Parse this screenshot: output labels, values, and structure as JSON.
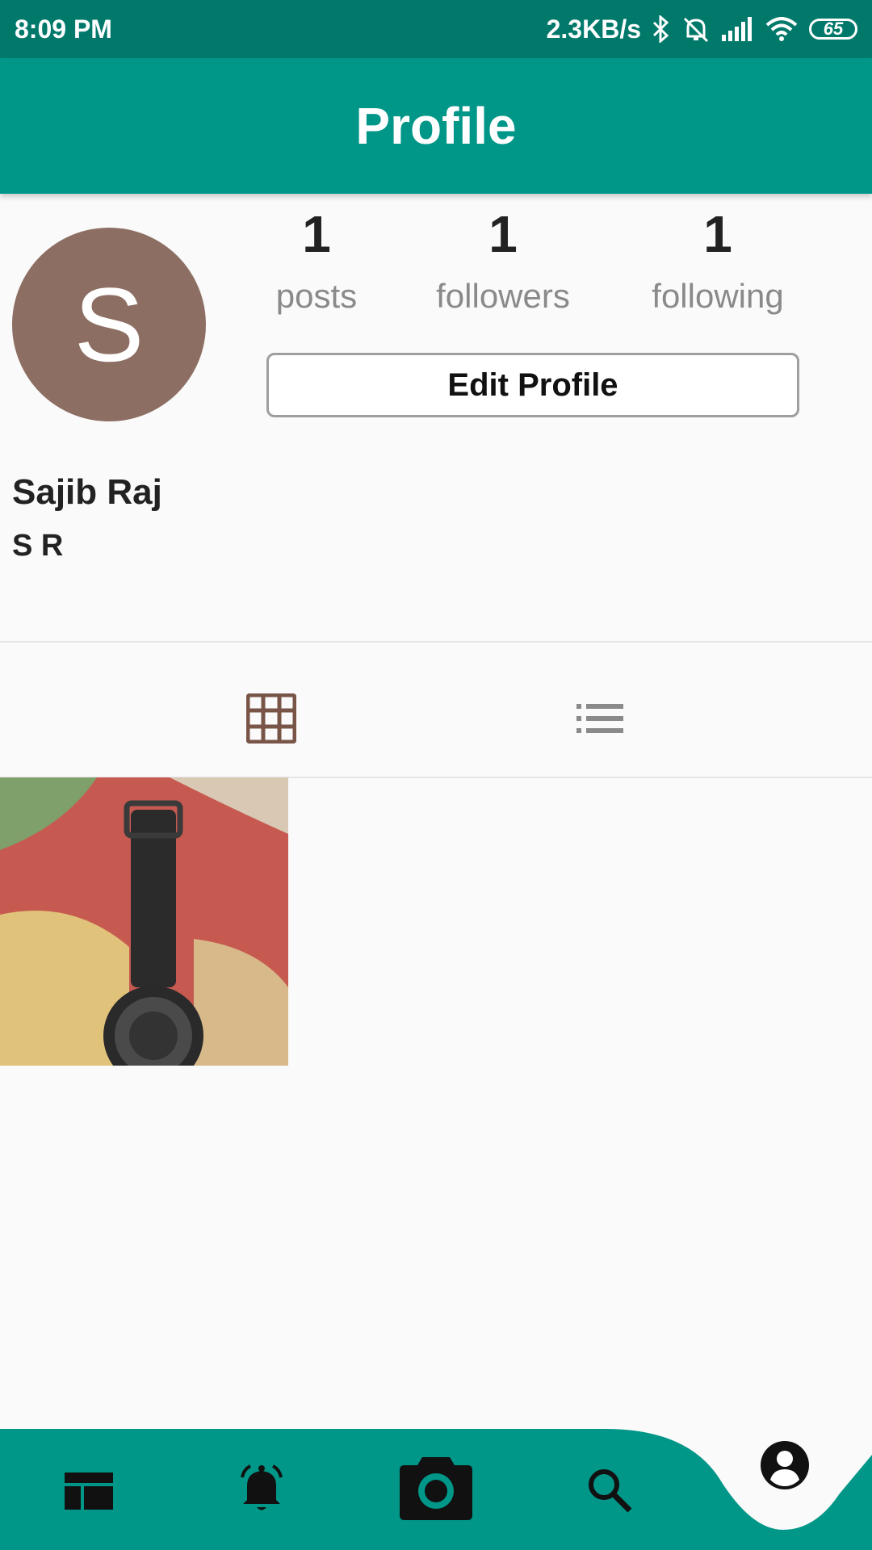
{
  "status_bar": {
    "time": "8:09 PM",
    "network_speed": "2.3KB/s",
    "battery": "65",
    "icons": [
      "bluetooth-icon",
      "bell-off-icon",
      "signal-icon",
      "wifi-icon",
      "battery-icon"
    ]
  },
  "app_bar": {
    "title": "Profile"
  },
  "profile": {
    "avatar_letter": "S",
    "avatar_color": "#8d6e63",
    "name": "Sajib Raj",
    "username": "S R"
  },
  "stats": [
    {
      "value": "1",
      "label": "posts"
    },
    {
      "value": "1",
      "label": "followers"
    },
    {
      "value": "1",
      "label": "following"
    }
  ],
  "edit_button": {
    "label": "Edit Profile"
  },
  "view_tabs": [
    {
      "icon": "grid-icon",
      "active": true
    },
    {
      "icon": "list-icon",
      "active": false
    }
  ],
  "posts": [
    {
      "alt": "wrist watch photo"
    }
  ],
  "bottom_nav": [
    {
      "icon": "feed-icon",
      "active": false
    },
    {
      "icon": "bell-icon",
      "active": false
    },
    {
      "icon": "camera-icon",
      "active": false
    },
    {
      "icon": "search-icon",
      "active": false
    },
    {
      "icon": "account-icon",
      "active": true
    }
  ],
  "colors": {
    "primary": "#009688",
    "primary_dark": "#00796b",
    "accent_icon": "#795548"
  }
}
